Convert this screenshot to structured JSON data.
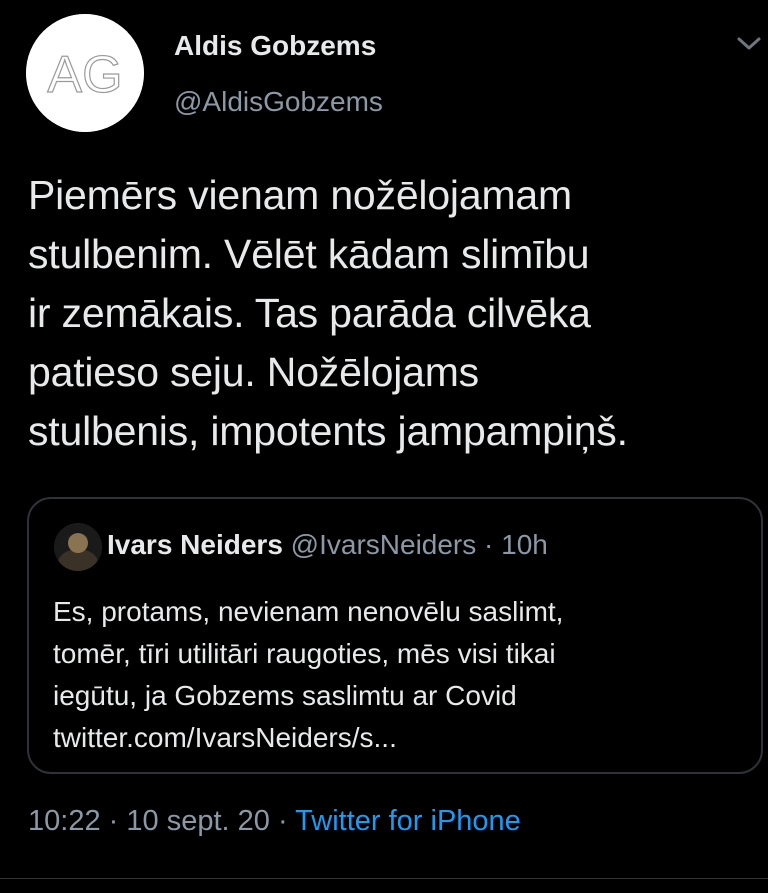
{
  "author": {
    "initials": "AG",
    "name": "Aldis Gobzems",
    "handle": "@AldisGobzems"
  },
  "tweet": {
    "text": "Piemērs vienam nožēlojamam\nstulbenim. Vēlēt kādam slimību\nir zemākais. Tas parāda cilvēka\npatieso seju. Nožēlojams\nstulbenis, impotents jampampiņš."
  },
  "quote": {
    "name": "Ivars Neiders",
    "handle": "@IvarsNeiders",
    "separator": "·",
    "time": "10h",
    "text": "Es, protams, nevienam nenovēlu saslimt,\ntomēr, tīri utilitāri raugoties, mēs visi tikai\niegūtu, ja Gobzems saslimtu ar Covid\ntwitter.com/IvarsNeiders/s..."
  },
  "meta": {
    "time": "10:22",
    "separator": "·",
    "date": "10 sept. 20",
    "source": "Twitter for iPhone"
  },
  "icons": {
    "caret": "chevron-down-icon"
  },
  "colors": {
    "background": "#000000",
    "text": "#e7e9ea",
    "secondary": "#8b98a5",
    "link": "#1d9bf0",
    "border": "#2f3336"
  }
}
